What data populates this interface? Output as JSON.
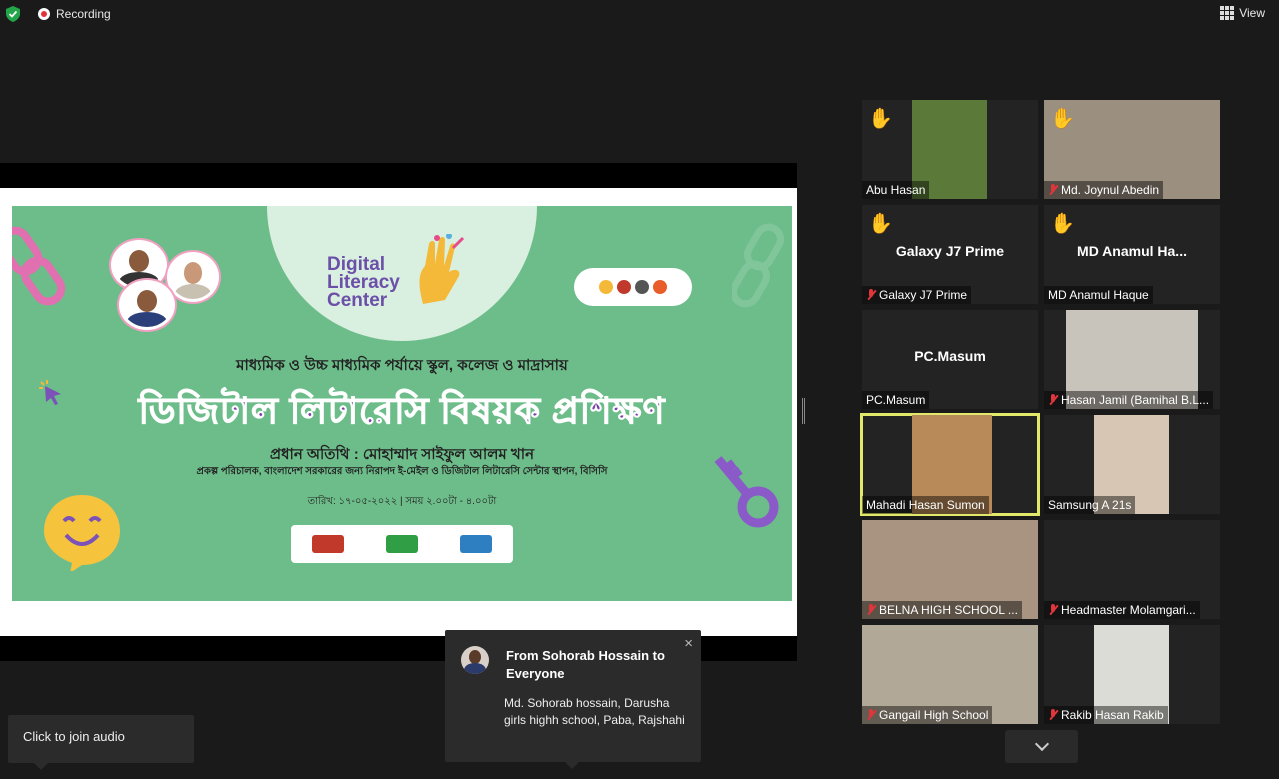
{
  "topbar": {
    "recording_label": "Recording",
    "view_label": "View"
  },
  "slide": {
    "logo_line1": "Digital",
    "logo_line2": "Literacy",
    "logo_line3": "Center",
    "subtitle": "মাধ্যমিক ও উচ্চ মাধ্যমিক পর্যায়ে স্কুল, কলেজ ও মাদ্রাসায়",
    "title": "ডিজিটাল লিটারেসি বিষয়ক প্রশিক্ষণ",
    "chief_guest": "প্রধান অতিথি : মোহাম্মাদ সাইফুল আলম খান",
    "designation": "প্রকল্প পরিচালক, বাংলাদেশ সরকারের জন্য নিরাপদ ই-মেইল ও ডিজিটাল লিটারেসি সেন্টার স্থাপন, বিসিসি",
    "date_time": "তারিখ: ১৭-০৫-২০২২ | সময় ২.০০টা - ৪.০০টা"
  },
  "participants": [
    {
      "name": "Abu Hasan",
      "center": "",
      "hand": true,
      "muted": false,
      "video": "#5b7a3a"
    },
    {
      "name": "Md. Joynul Abedin",
      "center": "",
      "hand": true,
      "muted": true,
      "video": "#9b8f80"
    },
    {
      "name": "Galaxy J7 Prime",
      "center": "Galaxy J7 Prime",
      "hand": true,
      "muted": true,
      "video": ""
    },
    {
      "name": "MD Anamul Haque",
      "center": "MD  Anamul  Ha...",
      "hand": true,
      "muted": false,
      "video": ""
    },
    {
      "name": "PC.Masum",
      "center": "PC.Masum",
      "hand": false,
      "muted": false,
      "video": ""
    },
    {
      "name": "Hasan Jamil (Bamihal B.L...",
      "center": "",
      "hand": false,
      "muted": true,
      "video": "#c9c4bb"
    },
    {
      "name": "Mahadi Hasan Sumon",
      "center": "",
      "hand": false,
      "muted": false,
      "video": "#b88a5a",
      "active": true
    },
    {
      "name": "Samsung A  21s",
      "center": "",
      "hand": false,
      "muted": false,
      "video": "#d8c6b4"
    },
    {
      "name": "BELNA HIGH SCHOOL ...",
      "center": "",
      "hand": false,
      "muted": true,
      "video": "#a89480"
    },
    {
      "name": "Headmaster Molamgari...",
      "center": "",
      "hand": false,
      "muted": true,
      "video": ""
    },
    {
      "name": "Gangail High School",
      "center": "",
      "hand": false,
      "muted": true,
      "video": "#b2a898"
    },
    {
      "name": "Rakib Hasan Rakib",
      "center": "",
      "hand": false,
      "muted": true,
      "video": "#dcdcd6"
    }
  ],
  "join_audio": {
    "label": "Click to join audio"
  },
  "chat": {
    "from": "From Sohorab Hossain to Everyone",
    "message": "Md. Sohorab hossain, Darusha girls highh school, Paba, Rajshahi",
    "close": "×"
  },
  "colors": {
    "slide_green": "#6dbd8a",
    "title_purple": "#7a3fb0",
    "active_speaker": "#e1e86a",
    "muted_red": "#e0353a",
    "raise_hand": "#f8c400"
  }
}
